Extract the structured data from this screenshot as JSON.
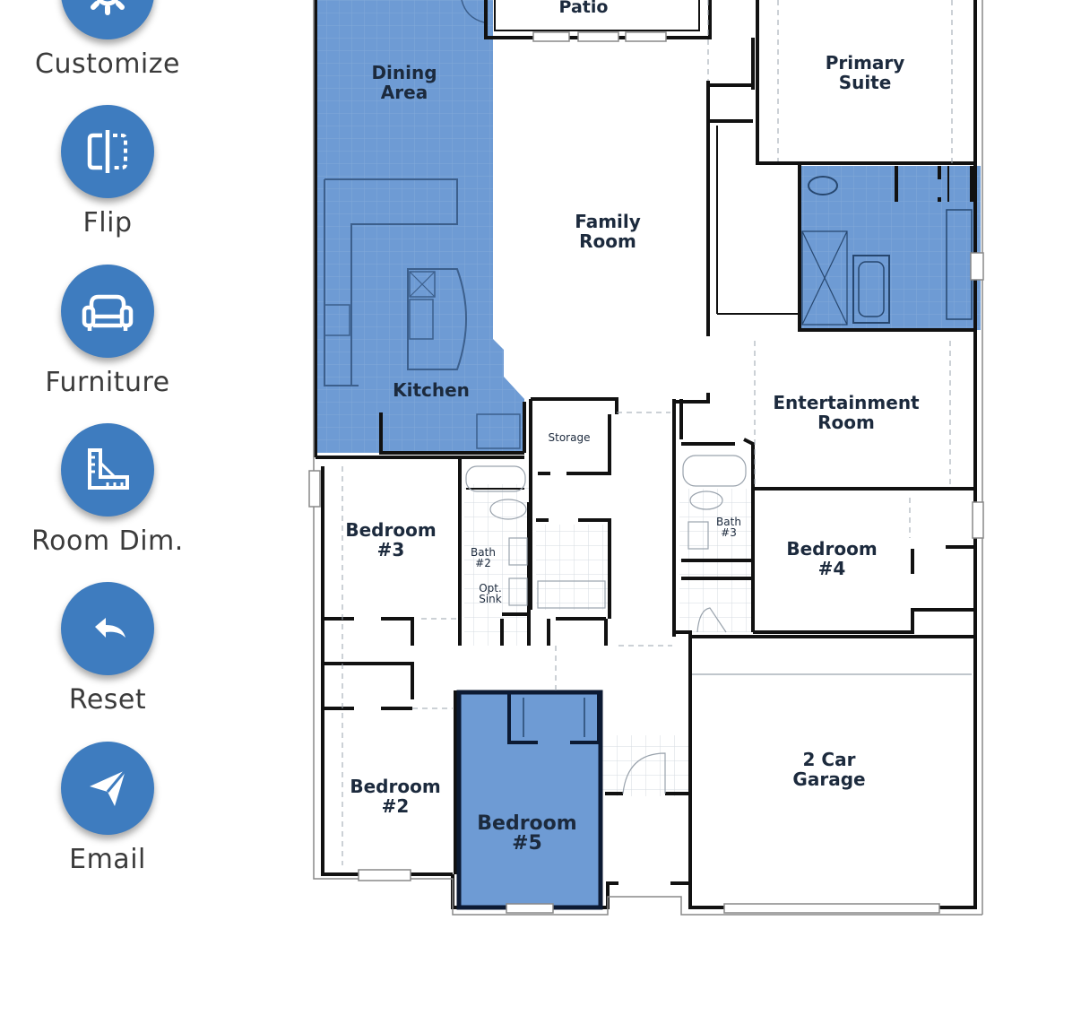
{
  "toolbar": {
    "customize_label": "Customize",
    "flip_label": "Flip",
    "furniture_label": "Furniture",
    "room_dim_label": "Room Dim.",
    "reset_label": "Reset",
    "email_label": "Email"
  },
  "colors": {
    "accent": "#3e7cbf",
    "highlight": "#5f90cf",
    "highlight_dark": "#7aa5d9",
    "wall": "#111111"
  },
  "floorplan": {
    "patio": "Patio",
    "dining_l1": "Dining",
    "dining_l2": "Area",
    "primary_l1": "Primary",
    "primary_l2": "Suite",
    "family_l1": "Family",
    "family_l2": "Room",
    "kitchen": "Kitchen",
    "storage": "Storage",
    "entertainment_l1": "Entertainment",
    "entertainment_l2": "Room",
    "bed3_l1": "Bedroom",
    "bed3_l2": "#3",
    "bath2_l1": "Bath",
    "bath2_l2": "#2",
    "opt_sink_l1": "Opt.",
    "opt_sink_l2": "Sink",
    "bath3_l1": "Bath",
    "bath3_l2": "#3",
    "bed4_l1": "Bedroom",
    "bed4_l2": "#4",
    "bed2_l1": "Bedroom",
    "bed2_l2": "#2",
    "bed5_l1": "Bedroom",
    "bed5_l2": "#5",
    "garage_l1": "2 Car",
    "garage_l2": "Garage"
  }
}
